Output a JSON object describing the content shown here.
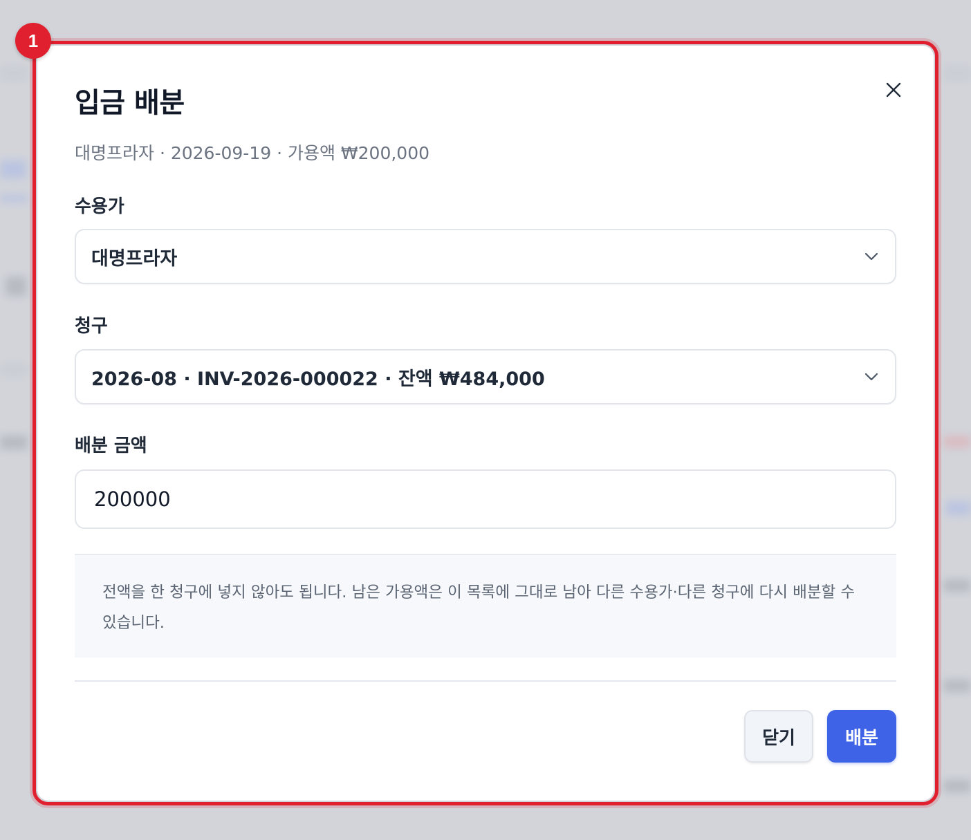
{
  "dialog": {
    "title": "입금 배분",
    "subtitle": "대명프라자 · 2026-09-19 · 가용액 ₩200,000",
    "step_badge": "1"
  },
  "fields": {
    "customer": {
      "label": "수용가",
      "value": "대명프라자"
    },
    "invoice": {
      "label": "청구",
      "value": "2026-08 · INV-2026-000022 · 잔액 ₩484,000"
    },
    "amount": {
      "label": "배분 금액",
      "value": "200000"
    }
  },
  "notice": "전액을 한 청구에 넣지 않아도 됩니다. 남은 가용액은 이 목록에 그대로 남아 다른 수용가·다른 청구에 다시 배분할 수 있습니다.",
  "buttons": {
    "close": "닫기",
    "allocate": "배분"
  },
  "colors": {
    "primary": "#3f63e6",
    "highlight": "#e0202e"
  }
}
